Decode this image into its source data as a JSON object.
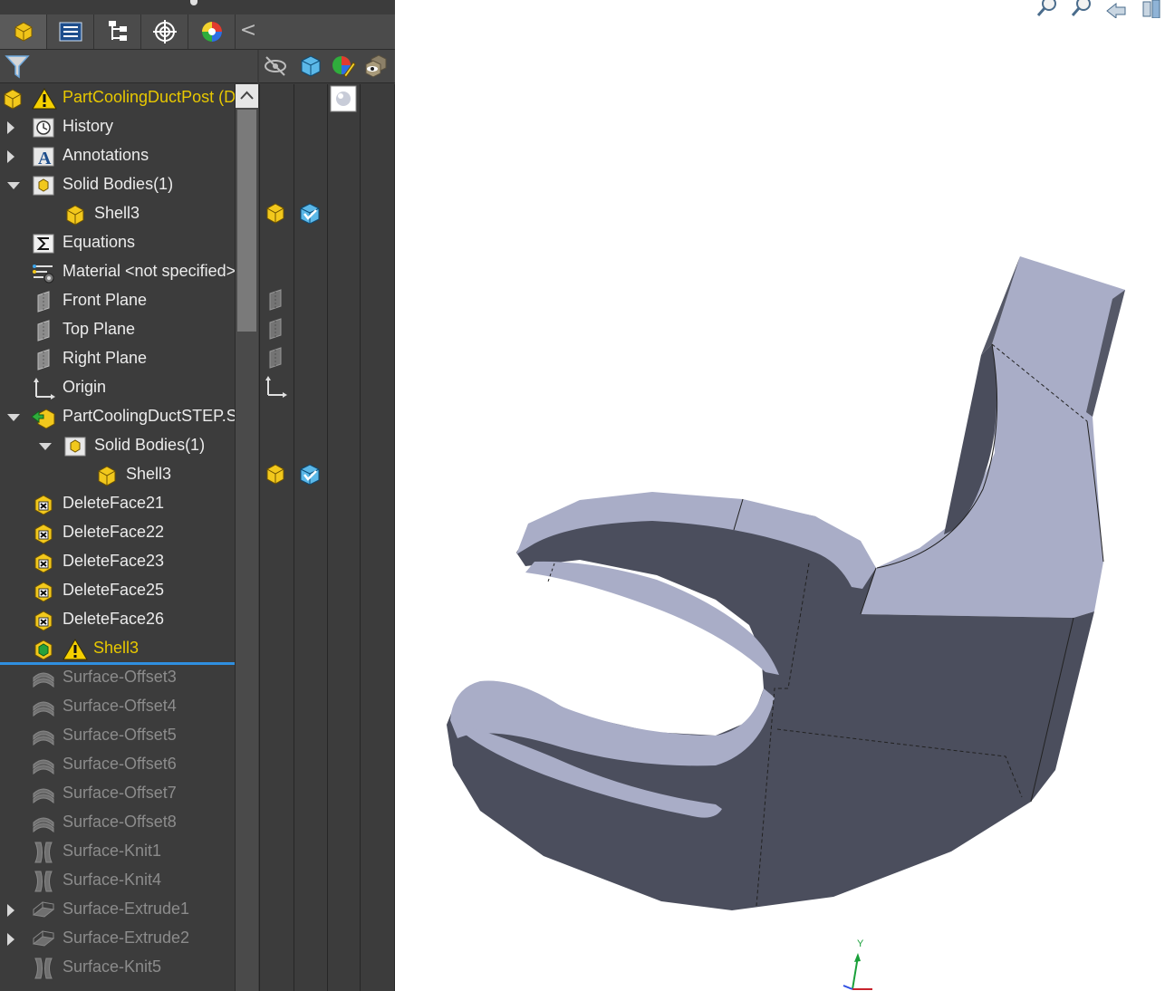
{
  "window": {
    "panel_tabs": [
      {
        "name": "FeatureManager Design Tree",
        "icon": "part-tree-icon",
        "active": true
      },
      {
        "name": "PropertyManager",
        "icon": "property-manager-icon",
        "active": false
      },
      {
        "name": "ConfigurationManager",
        "icon": "configuration-manager-icon",
        "active": false
      },
      {
        "name": "DimXpertManager",
        "icon": "dimxpert-target-icon",
        "active": false
      },
      {
        "name": "DisplayManager",
        "icon": "appearance-sphere-icon",
        "active": false
      }
    ],
    "collapse_glyph": "<"
  },
  "filter": {
    "icon": "filter-funnel-icon"
  },
  "display_pane_columns": [
    {
      "icon": "hide-show-eye-icon"
    },
    {
      "icon": "display-mode-cube-icon"
    },
    {
      "icon": "appearance-pencil-icon"
    },
    {
      "icon": "transparency-box-icon"
    }
  ],
  "tree": {
    "items": [
      {
        "label": "PartCoolingDuctPost (D",
        "icon": "part-icon",
        "warning": true,
        "style": "root",
        "expander": "none",
        "indent": 0
      },
      {
        "label": "History",
        "icon": "history-icon",
        "style": "normal",
        "expander": "right",
        "indent": 1
      },
      {
        "label": "Annotations",
        "icon": "annotations-icon",
        "style": "normal",
        "expander": "right",
        "indent": 1
      },
      {
        "label": "Solid Bodies(1)",
        "icon": "solid-bodies-folder-icon",
        "style": "normal",
        "expander": "down",
        "indent": 1
      },
      {
        "label": "Shell3",
        "icon": "solid-body-icon",
        "style": "normal",
        "expander": "none",
        "indent": 2
      },
      {
        "label": "Equations",
        "icon": "equations-sigma-icon",
        "style": "normal",
        "expander": "none",
        "indent": 1
      },
      {
        "label": "Material <not specified>",
        "icon": "material-icon",
        "style": "normal",
        "expander": "none",
        "indent": 1
      },
      {
        "label": "Front Plane",
        "icon": "plane-icon",
        "style": "normal",
        "expander": "none",
        "indent": 1
      },
      {
        "label": "Top Plane",
        "icon": "plane-icon",
        "style": "normal",
        "expander": "none",
        "indent": 1
      },
      {
        "label": "Right Plane",
        "icon": "plane-icon",
        "style": "normal",
        "expander": "none",
        "indent": 1
      },
      {
        "label": "Origin",
        "icon": "origin-icon",
        "style": "normal",
        "expander": "none",
        "indent": 1
      },
      {
        "label": "PartCoolingDuctSTEP.ST",
        "icon": "imported-part-icon",
        "style": "normal",
        "expander": "down",
        "indent": 1
      },
      {
        "label": "Solid Bodies(1)",
        "icon": "solid-bodies-folder-icon",
        "style": "normal",
        "expander": "down",
        "indent": 2
      },
      {
        "label": "Shell3",
        "icon": "solid-body-icon",
        "style": "normal",
        "expander": "none",
        "indent": 3
      },
      {
        "label": "DeleteFace21",
        "icon": "delete-face-icon",
        "style": "normal",
        "expander": "none",
        "indent": 1
      },
      {
        "label": "DeleteFace22",
        "icon": "delete-face-icon",
        "style": "normal",
        "expander": "none",
        "indent": 1
      },
      {
        "label": "DeleteFace23",
        "icon": "delete-face-icon",
        "style": "normal",
        "expander": "none",
        "indent": 1
      },
      {
        "label": "DeleteFace25",
        "icon": "delete-face-icon",
        "style": "normal",
        "expander": "none",
        "indent": 1
      },
      {
        "label": "DeleteFace26",
        "icon": "delete-face-icon",
        "style": "normal",
        "expander": "none",
        "indent": 1
      },
      {
        "label": "Shell3",
        "icon": "shell-feature-icon",
        "warning": true,
        "style": "selected",
        "expander": "none",
        "indent": 1
      },
      {
        "label": "Surface-Offset3",
        "icon": "surface-offset-icon",
        "style": "suppressed",
        "expander": "none",
        "indent": 1
      },
      {
        "label": "Surface-Offset4",
        "icon": "surface-offset-icon",
        "style": "suppressed",
        "expander": "none",
        "indent": 1
      },
      {
        "label": "Surface-Offset5",
        "icon": "surface-offset-icon",
        "style": "suppressed",
        "expander": "none",
        "indent": 1
      },
      {
        "label": "Surface-Offset6",
        "icon": "surface-offset-icon",
        "style": "suppressed",
        "expander": "none",
        "indent": 1
      },
      {
        "label": "Surface-Offset7",
        "icon": "surface-offset-icon",
        "style": "suppressed",
        "expander": "none",
        "indent": 1
      },
      {
        "label": "Surface-Offset8",
        "icon": "surface-offset-icon",
        "style": "suppressed",
        "expander": "none",
        "indent": 1
      },
      {
        "label": "Surface-Knit1",
        "icon": "surface-knit-icon",
        "style": "suppressed",
        "expander": "none",
        "indent": 1
      },
      {
        "label": "Surface-Knit4",
        "icon": "surface-knit-icon",
        "style": "suppressed",
        "expander": "none",
        "indent": 1
      },
      {
        "label": "Surface-Extrude1",
        "icon": "surface-extrude-icon",
        "style": "suppressed",
        "expander": "right",
        "indent": 1
      },
      {
        "label": "Surface-Extrude2",
        "icon": "surface-extrude-icon",
        "style": "suppressed",
        "expander": "right",
        "indent": 1
      },
      {
        "label": "Surface-Knit5",
        "icon": "surface-knit-icon",
        "style": "suppressed",
        "expander": "none",
        "indent": 1
      }
    ]
  },
  "display_pane_marks": [
    {
      "row": 0,
      "col": 2,
      "icon": "appearance-sphere-swatch-icon"
    },
    {
      "row": 4,
      "col": 0,
      "icon": "solid-body-icon"
    },
    {
      "row": 4,
      "col": 1,
      "icon": "shaded-edges-cube-icon"
    },
    {
      "row": 7,
      "col": 0,
      "icon": "plane-hidden-icon"
    },
    {
      "row": 8,
      "col": 0,
      "icon": "plane-hidden-icon"
    },
    {
      "row": 9,
      "col": 0,
      "icon": "plane-hidden-icon"
    },
    {
      "row": 10,
      "col": 0,
      "icon": "origin-hidden-icon"
    },
    {
      "row": 13,
      "col": 0,
      "icon": "solid-body-icon"
    },
    {
      "row": 13,
      "col": 1,
      "icon": "shaded-edges-cube-icon"
    }
  ],
  "viewport": {
    "view_tools": [
      {
        "name": "zoom-to-fit",
        "icon": "zoom-to-fit-icon"
      },
      {
        "name": "zoom-to-area",
        "icon": "zoom-to-area-icon"
      },
      {
        "name": "previous-view",
        "icon": "previous-view-icon"
      },
      {
        "name": "section-view",
        "icon": "section-view-icon"
      }
    ],
    "triad_axis_label": "Y",
    "model": {
      "icon": "duct-part-3d-model",
      "face_color": "#a7acc6",
      "side_color": "#494c5a"
    }
  },
  "colors": {
    "panel_bg": "#3c3c3c",
    "selected_text": "#e8c800",
    "selection_line": "#2f8fe0",
    "suppressed_text": "#8c8c8c"
  }
}
